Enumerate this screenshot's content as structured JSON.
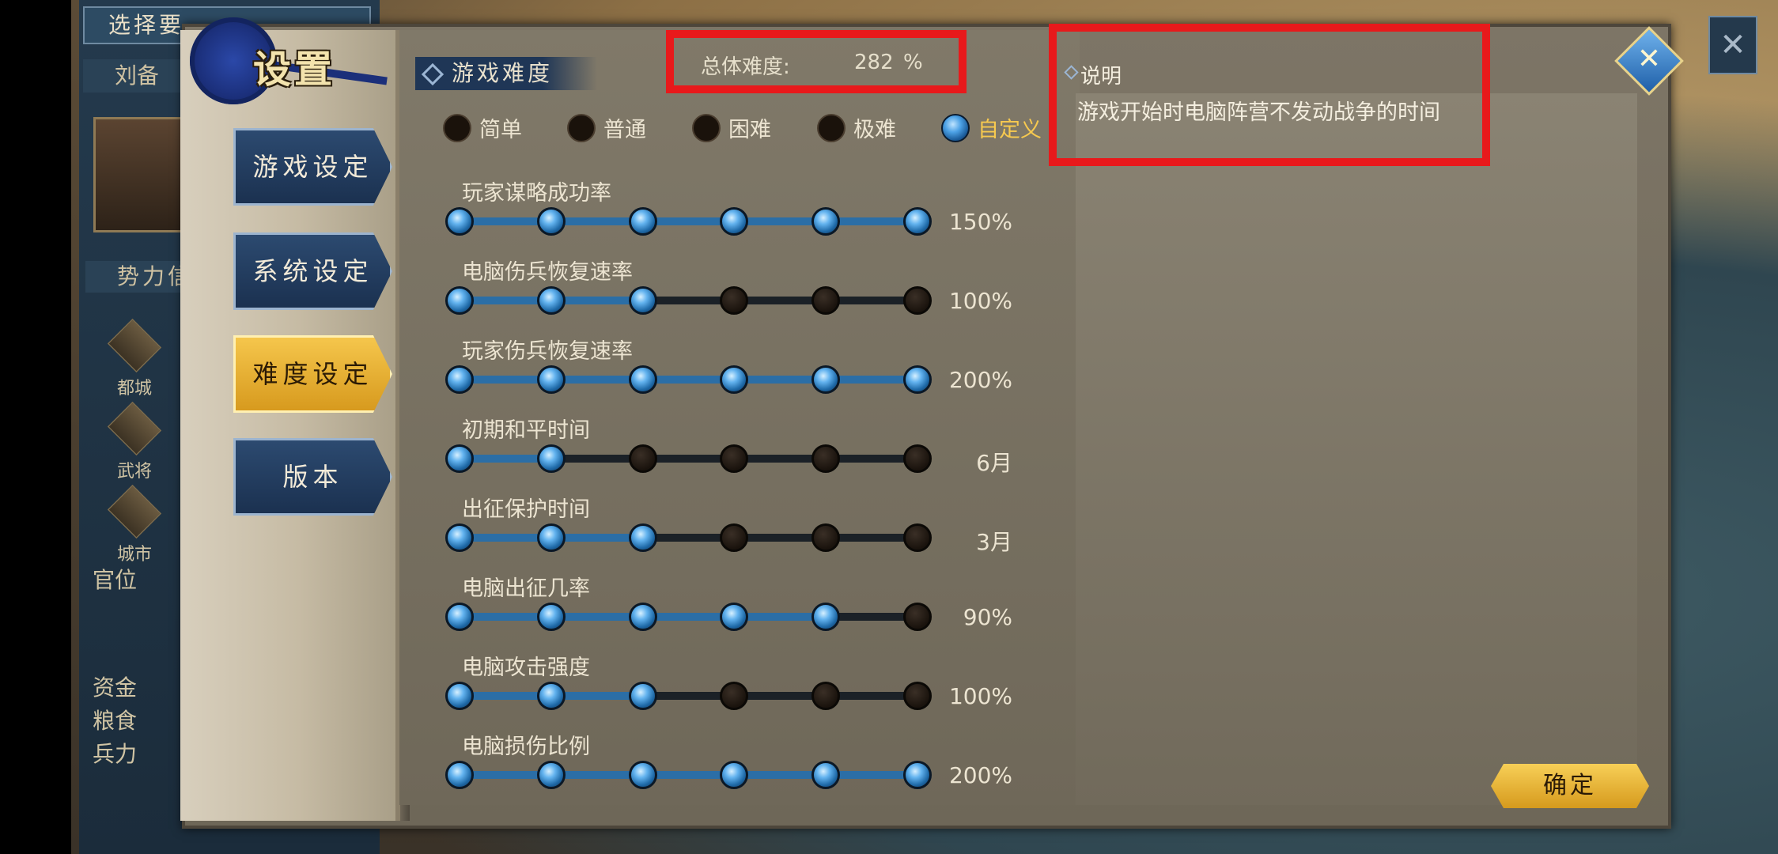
{
  "background_panel": {
    "title": "选择要",
    "title2": "势力",
    "ruler": "刘备",
    "section": "势力信",
    "categories": [
      "都城",
      "武将",
      "城市"
    ],
    "official": "官位",
    "stats": [
      "资金",
      "粮食",
      "兵力"
    ],
    "top_right_icon": "✕"
  },
  "dialog": {
    "title": "设置",
    "nav": [
      {
        "label": "游戏设定",
        "active": false
      },
      {
        "label": "系统设定",
        "active": false
      },
      {
        "label": "难度设定",
        "active": true
      },
      {
        "label": "版本",
        "active": false
      }
    ],
    "section_header": "游戏难度",
    "total_label": "总体难度:",
    "total_value": "282",
    "total_unit": "%",
    "difficulty_options": [
      {
        "label": "简单",
        "selected": false
      },
      {
        "label": "普通",
        "selected": false
      },
      {
        "label": "困难",
        "selected": false
      },
      {
        "label": "极难",
        "selected": false
      },
      {
        "label": "自定义",
        "selected": true
      }
    ],
    "sliders": [
      {
        "label": "玩家谋略成功率",
        "value": "150%",
        "level": 5,
        "steps": 6
      },
      {
        "label": "电脑伤兵恢复速率",
        "value": "100%",
        "level": 2,
        "steps": 6
      },
      {
        "label": "玩家伤兵恢复速率",
        "value": "200%",
        "level": 5,
        "steps": 6
      },
      {
        "label": "初期和平时间",
        "value": "6月",
        "level": 1,
        "steps": 6
      },
      {
        "label": "出征保护时间",
        "value": "3月",
        "level": 2,
        "steps": 6
      },
      {
        "label": "电脑出征几率",
        "value": "90%",
        "level": 4,
        "steps": 6
      },
      {
        "label": "电脑攻击强度",
        "value": "100%",
        "level": 2,
        "steps": 6
      },
      {
        "label": "电脑损伤比例",
        "value": "200%",
        "level": 5,
        "steps": 6
      }
    ],
    "description_header": "说明",
    "description_text": "游戏开始时电脑阵营不发动战争的时间",
    "confirm_label": "确定",
    "close_icon": "✕"
  },
  "colors": {
    "highlight_box": "#e8191b",
    "selected_text": "#f7c94f",
    "active_nav": "#f5c64c"
  }
}
